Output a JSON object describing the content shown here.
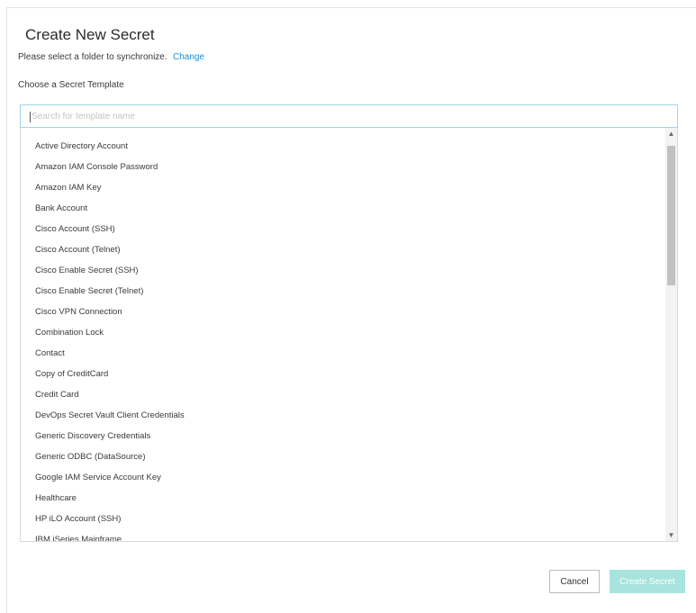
{
  "dialog": {
    "title": "Create New Secret",
    "folder_prompt": "Please select a folder to synchronize.",
    "change_link": "Change",
    "template_label": "Choose a Secret Template",
    "search_placeholder": "Search for template name"
  },
  "templates": [
    "Active Directory Account",
    "Amazon IAM Console Password",
    "Amazon IAM Key",
    "Bank Account",
    "Cisco Account (SSH)",
    "Cisco Account (Telnet)",
    "Cisco Enable Secret (SSH)",
    "Cisco Enable Secret (Telnet)",
    "Cisco VPN Connection",
    "Combination Lock",
    "Contact",
    "Copy of CreditCard",
    "Credit Card",
    "DevOps Secret Vault Client Credentials",
    "Generic Discovery Credentials",
    "Generic ODBC (DataSource)",
    "Google IAM Service Account Key",
    "Healthcare",
    "HP iLO Account (SSH)",
    "IBM iSeries Mainframe"
  ],
  "scrollbar": {
    "up_icon": "chevron-up-icon",
    "down_icon": "chevron-down-icon",
    "position": 0.0
  },
  "buttons": {
    "cancel": "Cancel",
    "create": "Create Secret",
    "create_enabled": false
  },
  "colors": {
    "link": "#1a8fd8",
    "search_border": "#9fd6e8",
    "create_button_bg": "#a6e4dd"
  }
}
